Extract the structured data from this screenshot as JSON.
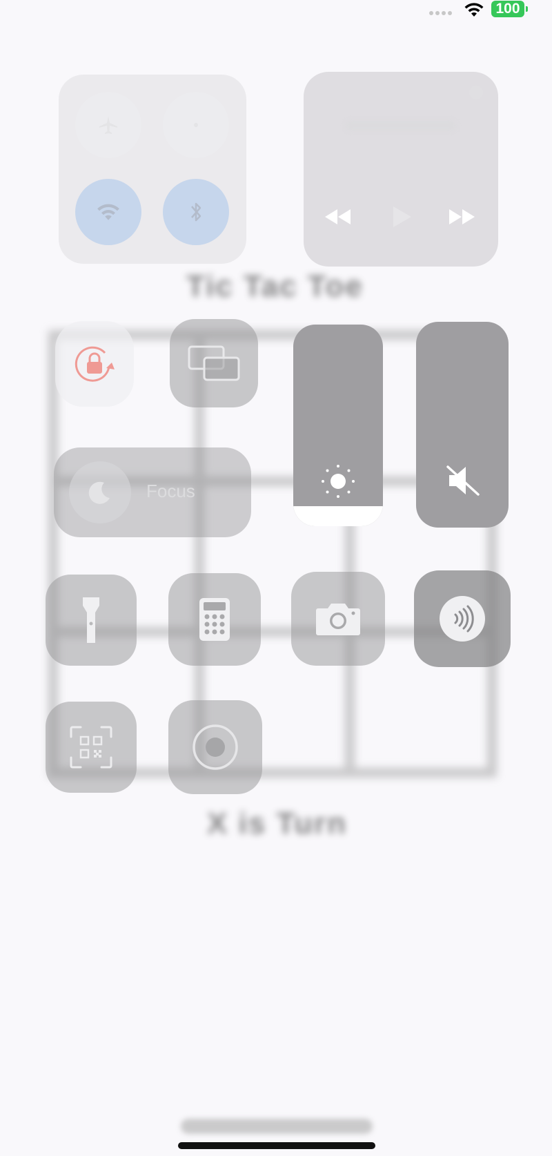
{
  "status_bar": {
    "battery": "100"
  },
  "background": {
    "title_blurred": "Tic Tac Toe",
    "turn_blurred": "X is Turn"
  },
  "control_center": {
    "connectivity": {
      "airplane": {
        "state": "off",
        "icon": "airplane-icon"
      },
      "cellular": {
        "state": "off",
        "icon": "cellular-icon"
      },
      "wifi": {
        "state": "on",
        "icon": "wifi-icon"
      },
      "bluetooth": {
        "state": "on",
        "icon": "bluetooth-icon"
      }
    },
    "media": {
      "controls": [
        "rewind-icon",
        "play-icon",
        "fast-forward-icon"
      ]
    },
    "orientation_lock": {
      "icon": "rotation-lock-icon"
    },
    "screen_mirroring": {
      "icon": "screen-mirroring-icon"
    },
    "brightness": {
      "level": 0.1,
      "icon": "sun-icon"
    },
    "volume": {
      "level": 0.0,
      "icon": "speaker-muted-icon"
    },
    "focus": {
      "label": "Focus",
      "icon": "moon-icon"
    },
    "shortcuts": [
      {
        "name": "flashlight",
        "icon": "flashlight-icon"
      },
      {
        "name": "calculator",
        "icon": "calculator-icon"
      },
      {
        "name": "camera",
        "icon": "camera-icon"
      },
      {
        "name": "nfc",
        "icon": "nfc-icon"
      },
      {
        "name": "code-scanner",
        "icon": "qr-code-icon"
      },
      {
        "name": "screen-recording",
        "icon": "record-icon"
      }
    ]
  },
  "colors": {
    "accent_on": "#c6d6ec",
    "battery_green": "#36c759",
    "rotation_red": "#e8534a"
  }
}
